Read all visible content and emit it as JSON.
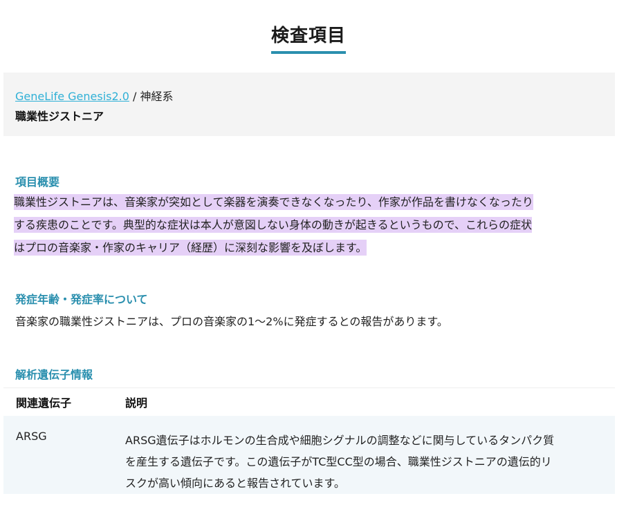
{
  "page": {
    "title": "検査項目"
  },
  "breadcrumb": {
    "link": "GeneLife Genesis2.0",
    "separator": " / ",
    "category": "神経系",
    "item_title": "職業性ジストニア"
  },
  "overview": {
    "heading": "項目概要",
    "lines": [
      "職業性ジストニアは、音楽家が突如として楽器を演奏できなくなったり、作家が作品を書けなくなったり",
      "する疾患のことです。典型的な症状は本人が意図しない身体の動きが起きるというもので、これらの症状",
      "はプロの音楽家・作家のキャリア（経歴）に深刻な影響を及ぼします。"
    ]
  },
  "onset": {
    "heading": "発症年齢・発症率について",
    "text": "音楽家の職業性ジストニアは、プロの音楽家の1〜2%に発症するとの報告があります。"
  },
  "genes": {
    "heading": "解析遺伝子情報",
    "columns": [
      "関連遺伝子",
      "説明"
    ],
    "rows": [
      {
        "gene": "ARSG",
        "description_lines": [
          "ARSG遺伝子はホルモンの生合成や細胞シグナルの調整などに関与しているタンパク質",
          "を産生する遺伝子です。この遺伝子がTC型CC型の場合、職業性ジストニアの遺伝的リ",
          "スクが高い傾向にあると報告されています。"
        ]
      }
    ]
  },
  "colors": {
    "accent": "#2a8fae",
    "link": "#2fb0d6",
    "highlight": "#e5d0f7",
    "panel": "#f4f4f4",
    "table_row": "#f2f7fa"
  }
}
